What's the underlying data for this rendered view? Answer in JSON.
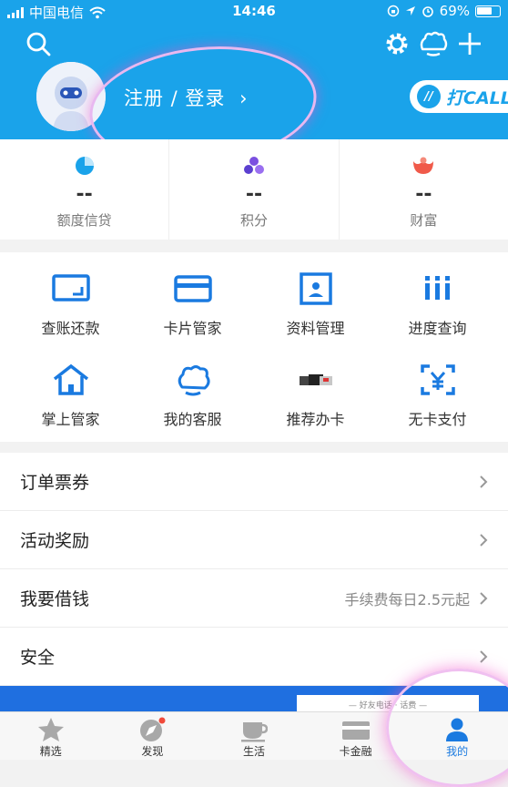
{
  "status_bar": {
    "carrier": "中国电信",
    "time": "14:46",
    "battery": "69%"
  },
  "header": {
    "login_text": "注册 / 登录",
    "login_chevron": "›",
    "call_button": "打CALL",
    "call_badge": "//"
  },
  "stats": [
    {
      "value": "--",
      "label": "额度信贷",
      "icon": "credit-icon",
      "color": "#1aa3ea"
    },
    {
      "value": "--",
      "label": "积分",
      "icon": "points-icon",
      "color": "#7b4fe0"
    },
    {
      "value": "--",
      "label": "财富",
      "icon": "wealth-icon",
      "color": "#f05a4a"
    }
  ],
  "grid": [
    {
      "label": "查账还款",
      "icon": "bill-icon"
    },
    {
      "label": "卡片管家",
      "icon": "card-icon"
    },
    {
      "label": "资料管理",
      "icon": "profile-icon"
    },
    {
      "label": "进度查询",
      "icon": "progress-icon"
    },
    {
      "label": "掌上管家",
      "icon": "home-icon"
    },
    {
      "label": "我的客服",
      "icon": "service-icon"
    },
    {
      "label": "推荐办卡",
      "icon": "recommend-card-icon"
    },
    {
      "label": "无卡支付",
      "icon": "cardless-pay-icon"
    }
  ],
  "list": [
    {
      "label": "订单票券",
      "value": ""
    },
    {
      "label": "活动奖励",
      "value": ""
    },
    {
      "label": "我要借钱",
      "value": "手续费每日2.5元起"
    },
    {
      "label": "安全",
      "value": ""
    }
  ],
  "banner": {
    "text": "— 好友电话 · 话费 —"
  },
  "tabs": [
    {
      "label": "精选",
      "icon": "star-icon",
      "active": false
    },
    {
      "label": "发现",
      "icon": "compass-icon",
      "active": false
    },
    {
      "label": "生活",
      "icon": "cup-icon",
      "active": false
    },
    {
      "label": "卡金融",
      "icon": "card-finance-icon",
      "active": false
    },
    {
      "label": "我的",
      "icon": "person-icon",
      "active": true
    }
  ],
  "colors": {
    "primary": "#1aa3ea",
    "active_tab": "#1a7ae0",
    "banner": "#1f6fe0"
  }
}
